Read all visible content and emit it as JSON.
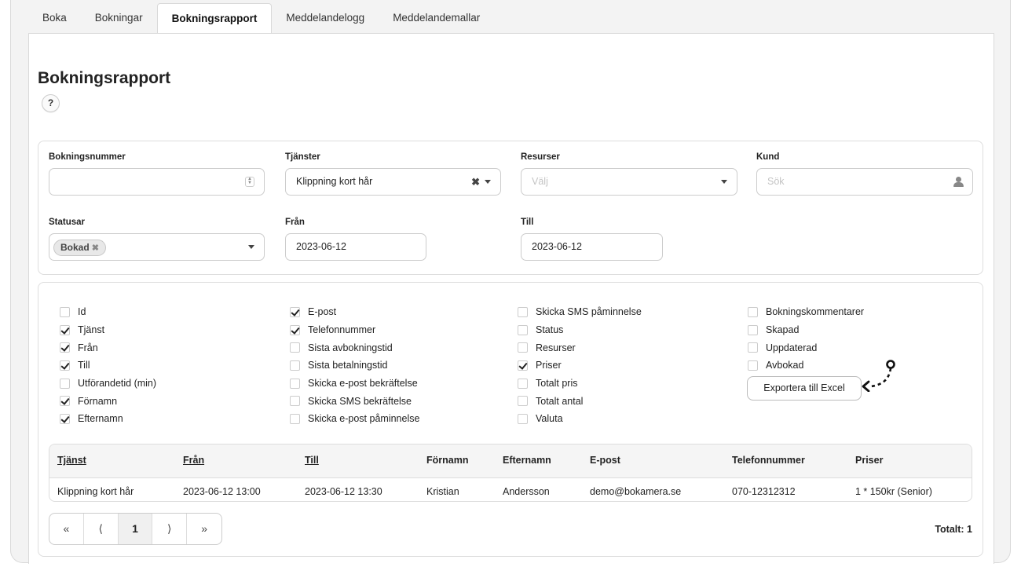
{
  "tabs": [
    {
      "label": "Boka"
    },
    {
      "label": "Bokningar"
    },
    {
      "label": "Bokningsrapport"
    },
    {
      "label": "Meddelandelogg"
    },
    {
      "label": "Meddelandemallar"
    }
  ],
  "page": {
    "title": "Bokningsrapport",
    "help": "?"
  },
  "filters": {
    "booking_number": {
      "label": "Bokningsnummer",
      "value": ""
    },
    "services": {
      "label": "Tjänster",
      "value": "Klippning kort hår"
    },
    "resources": {
      "label": "Resurser",
      "placeholder": "Välj"
    },
    "customer": {
      "label": "Kund",
      "placeholder": "Sök"
    },
    "statuses": {
      "label": "Statusar",
      "tag": "Bokad"
    },
    "from": {
      "label": "Från",
      "value": "2023-06-12"
    },
    "to": {
      "label": "Till",
      "value": "2023-06-12"
    }
  },
  "columns_options": [
    [
      {
        "label": "Id",
        "checked": false
      },
      {
        "label": "Tjänst",
        "checked": true
      },
      {
        "label": "Från",
        "checked": true
      },
      {
        "label": "Till",
        "checked": true
      },
      {
        "label": "Utförandetid (min)",
        "checked": false
      },
      {
        "label": "Förnamn",
        "checked": true
      },
      {
        "label": "Efternamn",
        "checked": true
      }
    ],
    [
      {
        "label": "E-post",
        "checked": true
      },
      {
        "label": "Telefonnummer",
        "checked": true
      },
      {
        "label": "Sista avbokningstid",
        "checked": false
      },
      {
        "label": "Sista betalningstid",
        "checked": false
      },
      {
        "label": "Skicka e-post bekräftelse",
        "checked": false
      },
      {
        "label": "Skicka SMS bekräftelse",
        "checked": false
      },
      {
        "label": "Skicka e-post påminnelse",
        "checked": false
      }
    ],
    [
      {
        "label": "Skicka SMS påminnelse",
        "checked": false
      },
      {
        "label": "Status",
        "checked": false
      },
      {
        "label": "Resurser",
        "checked": false
      },
      {
        "label": "Priser",
        "checked": true
      },
      {
        "label": "Totalt pris",
        "checked": false
      },
      {
        "label": "Totalt antal",
        "checked": false
      },
      {
        "label": "Valuta",
        "checked": false
      }
    ],
    [
      {
        "label": "Bokningskommentarer",
        "checked": false
      },
      {
        "label": "Skapad",
        "checked": false
      },
      {
        "label": "Uppdaterad",
        "checked": false
      },
      {
        "label": "Avbokad",
        "checked": false
      }
    ]
  ],
  "export_button": "Exportera till Excel",
  "table": {
    "headers": [
      "Tjänst",
      "Från",
      "Till",
      "Förnamn",
      "Efternamn",
      "E-post",
      "Telefonnummer",
      "Priser"
    ],
    "rows": [
      [
        "Klippning kort hår",
        "2023-06-12 13:00",
        "2023-06-12 13:30",
        "Kristian",
        "Andersson",
        "demo@bokamera.se",
        "070-12312312",
        "1 * 150kr (Senior)"
      ]
    ]
  },
  "pager": {
    "first": "«",
    "prev": "⟨",
    "current": "1",
    "next": "⟩",
    "last": "»"
  },
  "total": "Totalt: 1"
}
